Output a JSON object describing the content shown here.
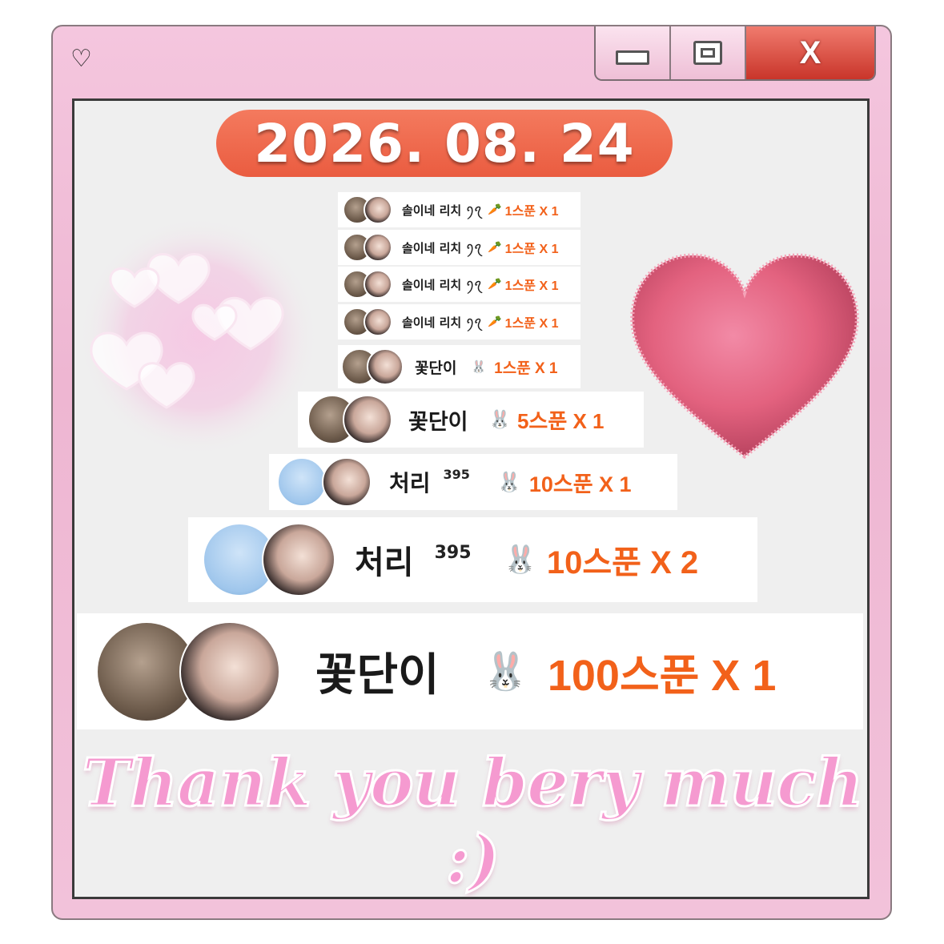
{
  "window": {
    "title_icon": "heart-icon",
    "minimize_icon": "minimize-icon",
    "maximize_icon": "maximize-icon",
    "close_label": "X"
  },
  "date": "2026. 08. 24",
  "rows": [
    {
      "name": "솔이네 리치",
      "badge": "ꪆꪖ",
      "gift": "🥕",
      "amount": "1스푼 X 1"
    },
    {
      "name": "솔이네 리치",
      "badge": "ꪆꪖ",
      "gift": "🥕",
      "amount": "1스푼 X 1"
    },
    {
      "name": "솔이네 리치",
      "badge": "ꪆꪖ",
      "gift": "🥕",
      "amount": "1스푼 X 1"
    },
    {
      "name": "솔이네 리치",
      "badge": "ꪆꪖ",
      "gift": "🥕",
      "amount": "1스푼 X 1"
    },
    {
      "name": "꽃단이",
      "badge": "",
      "gift": "🐰",
      "amount": "1스푼 X 1"
    },
    {
      "name": "꽃단이",
      "badge": "",
      "gift": "🐰",
      "amount": "5스푼 X 1"
    },
    {
      "name": "처리",
      "badge": "395",
      "gift": "🐰",
      "amount": "10스푼 X 1"
    },
    {
      "name": "처리",
      "badge": "395",
      "gift": "🐰",
      "amount": "10스푼 X 2"
    },
    {
      "name": "꽃단이",
      "badge": "",
      "gift": "🐰",
      "amount": "100스푼 X 1"
    }
  ],
  "thanks": "Thank you bery much :)",
  "colors": {
    "accent": "#ea5c40",
    "amount": "#f2611a",
    "thanks": "#f59ad0",
    "window": "#f2c2da"
  }
}
